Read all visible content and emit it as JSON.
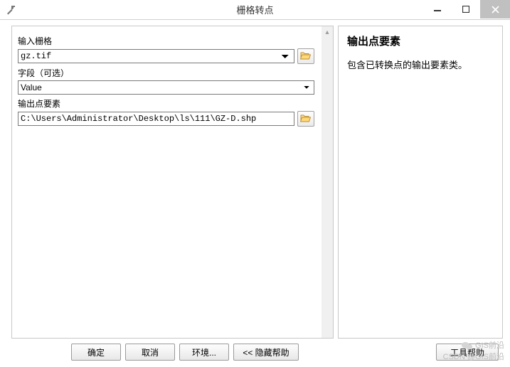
{
  "window": {
    "title": "栅格转点",
    "buttons": {
      "min": "–",
      "max": "☐",
      "close": "×"
    }
  },
  "form": {
    "inputRaster": {
      "label": "输入栅格",
      "value": "gz.tif"
    },
    "field": {
      "label": "字段（可选）",
      "value": "Value"
    },
    "output": {
      "label": "输出点要素",
      "value": "C:\\Users\\Administrator\\Desktop\\ls\\111\\GZ-D.shp"
    }
  },
  "help": {
    "title": "输出点要素",
    "description": "包含已转换点的输出要素类。"
  },
  "footer": {
    "ok": "确定",
    "cancel": "取消",
    "environments": "环境...",
    "hideHelp": "<< 隐藏帮助",
    "toolHelp": "工具帮助"
  },
  "watermark": {
    "line1": "GIS前沿",
    "line2": "CSDN @GIS前沿"
  }
}
